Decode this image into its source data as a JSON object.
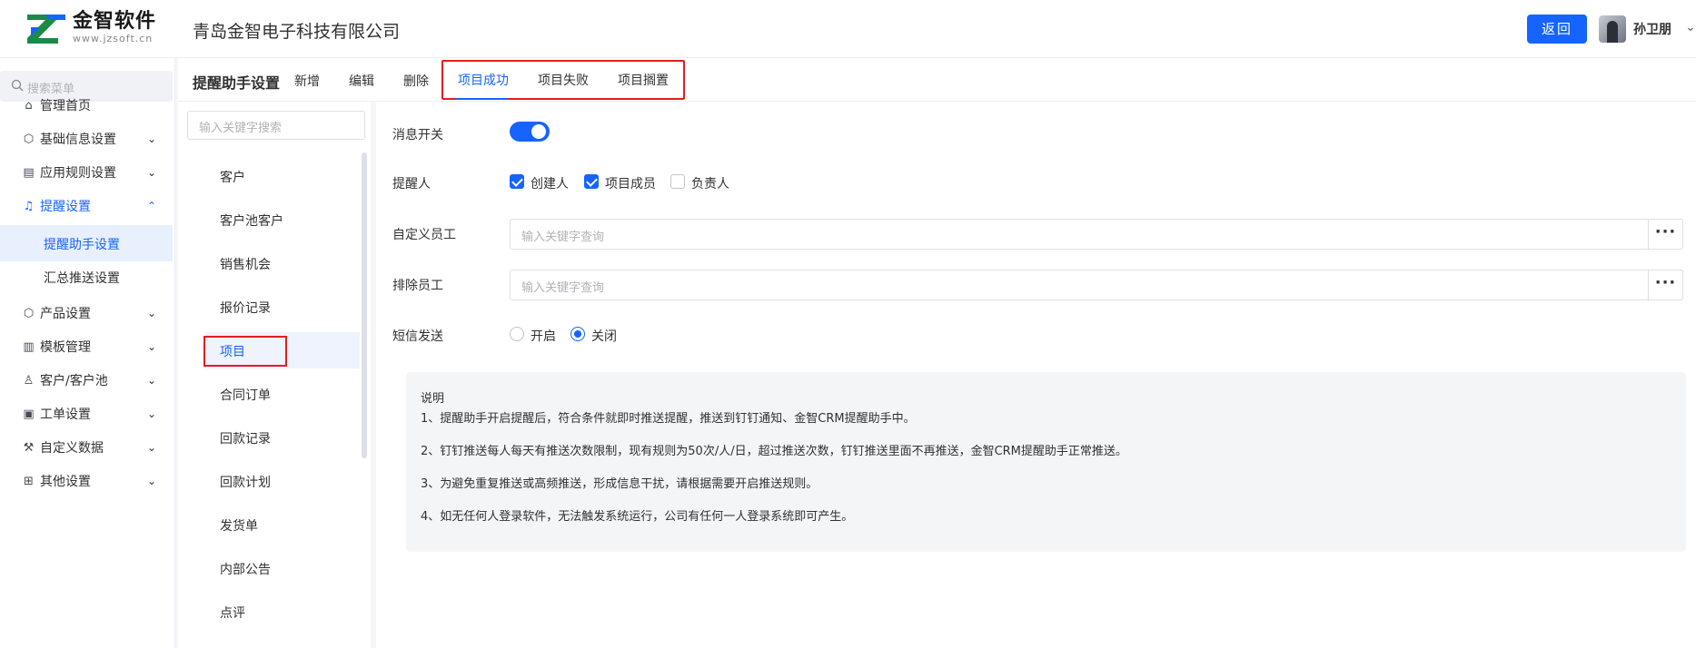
{
  "brand": {
    "name": "金智软件",
    "url": "www.jzsoft.cn",
    "color": "#1664ff"
  },
  "header": {
    "company": "青岛金智电子科技有限公司",
    "back_label": "返回",
    "user_name": "孙卫朋"
  },
  "sidebar": {
    "search_placeholder": "搜索菜单",
    "items": [
      {
        "label": "管理首页",
        "icon": "home-icon"
      },
      {
        "label": "基础信息设置",
        "icon": "cube-icon"
      },
      {
        "label": "应用规则设置",
        "icon": "document-icon"
      },
      {
        "label": "提醒设置",
        "icon": "bell-icon"
      },
      {
        "label": "产品设置",
        "icon": "cube-icon"
      },
      {
        "label": "模板管理",
        "icon": "template-icon"
      },
      {
        "label": "客户/客户池",
        "icon": "user-icon"
      },
      {
        "label": "工单设置",
        "icon": "ticket-icon"
      },
      {
        "label": "自定义数据",
        "icon": "custom-icon"
      },
      {
        "label": "其他设置",
        "icon": "grid-icon"
      }
    ],
    "sub_items": [
      {
        "label": "提醒助手设置"
      },
      {
        "label": "汇总推送设置"
      }
    ]
  },
  "toolbar": {
    "title": "提醒助手设置",
    "add_label": "新增",
    "edit_label": "编辑",
    "delete_label": "删除",
    "tabs": [
      {
        "label": "项目成功"
      },
      {
        "label": "项目失败"
      },
      {
        "label": "项目搁置"
      }
    ],
    "active_tab": "项目成功"
  },
  "list": {
    "search_placeholder": "输入关键字搜索",
    "items": [
      "客户",
      "客户池客户",
      "销售机会",
      "报价记录",
      "项目",
      "合同订单",
      "回款记录",
      "回款计划",
      "发货单",
      "内部公告",
      "点评"
    ],
    "selected": "项目"
  },
  "form": {
    "msg_switch_label": "消息开关",
    "msg_switch_on": true,
    "reminder_label": "提醒人",
    "reminders": [
      {
        "label": "创建人",
        "checked": true
      },
      {
        "label": "项目成员",
        "checked": true
      },
      {
        "label": "负责人",
        "checked": false
      }
    ],
    "custom_staff_label": "自定义员工",
    "custom_staff_placeholder": "输入关键字查询",
    "exclude_staff_label": "排除员工",
    "exclude_staff_placeholder": "输入关键字查询",
    "more_label": "···",
    "sms_label": "短信发送",
    "sms_options": [
      {
        "label": "开启",
        "selected": false
      },
      {
        "label": "关闭",
        "selected": true
      }
    ]
  },
  "notes": {
    "title": "说明",
    "lines": [
      "1、提醒助手开启提醒后，符合条件就即时推送提醒，推送到钉钉通知、金智CRM提醒助手中。",
      "2、钉钉推送每人每天有推送次数限制，现有规则为50次/人/日，超过推送次数，钉钉推送里面不再推送，金智CRM提醒助手正常推送。",
      "3、为避免重复推送或高频推送，形成信息干扰，请根据需要开启推送规则。",
      "4、如无任何人登录软件，无法触发系统运行，公司有任何一人登录系统即可产生。"
    ]
  }
}
